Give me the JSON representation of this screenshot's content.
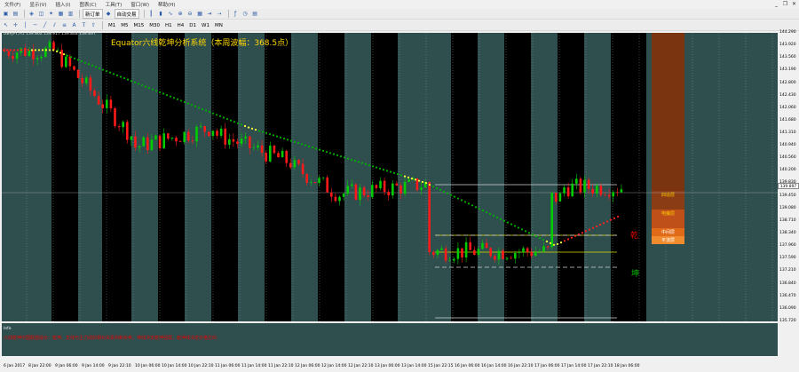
{
  "window": {
    "controls": [
      "_",
      "❐",
      "✕"
    ]
  },
  "menu": [
    "文件(F)",
    "显示(V)",
    "插入(I)",
    "图表(C)",
    "工具(T)",
    "窗口(W)",
    "帮助(H)"
  ],
  "toolbar": {
    "new_order": "新订单",
    "auto_trading": "自动交易",
    "timeframes": [
      "M1",
      "M5",
      "M15",
      "M30",
      "H1",
      "H4",
      "D1",
      "W1",
      "MN"
    ]
  },
  "chart": {
    "symbol_label": "GBPJPY,H1  139.862 139.917 139.848 139.897",
    "title": "Equator六线乾坤分析系统（本周波幅：368.5点）",
    "qian": "乾",
    "kun": "坤",
    "current_price": "139.897",
    "levels": [
      {
        "label": "四造层",
        "color": "#ffcc00",
        "bg": "#7a3410"
      },
      {
        "label": "电魔层",
        "color": "#ffcc00",
        "bg": "#c0501a"
      },
      {
        "label": "中间层",
        "color": "#ffffff",
        "bg": "#e06a18"
      },
      {
        "label": "平流层",
        "color": "#ffffff",
        "bg": "#f08c2e"
      }
    ],
    "info_label": "Info",
    "info_text": "六线乾坤中国联盟提示：乾坤、支线与主力线的相对关系判断买卖，坤线决定乾坤强弱，乾坤线决定价格方向"
  },
  "chart_data": {
    "type": "candlestick",
    "symbol": "GBPJPY",
    "timeframe": "H1",
    "y_ticks": [
      "144.290",
      "143.920",
      "143.560",
      "143.190",
      "142.800",
      "142.430",
      "142.060",
      "141.680",
      "141.310",
      "140.940",
      "140.560",
      "140.200",
      "139.830",
      "139.450",
      "139.080",
      "138.710",
      "138.340",
      "137.960",
      "137.590",
      "137.210",
      "136.840",
      "136.470",
      "136.090",
      "135.720"
    ],
    "x_ticks": [
      "6 Jan 2017",
      "8 Jan 22:00",
      "9 Jan 06:00",
      "9 Jan 14:00",
      "9 Jan 22:10",
      "10 Jan 06:00",
      "10 Jan 14:00",
      "10 Jan 22:10",
      "11 Jan 06:00",
      "11 Jan 14:00",
      "11 Jan 22:10",
      "12 Jan 06:00",
      "12 Jan 14:00",
      "12 Jan 22:10",
      "13 Jan 06:00",
      "13 Jan 14:00",
      "15 Jan 22:15",
      "16 Jan 06:00",
      "16 Jan 14:00",
      "16 Jan 22:10",
      "17 Jan 06:00",
      "17 Jan 14:00",
      "17 Jan 22:10",
      "18 Jan 06:00"
    ],
    "ylim": [
      135.72,
      144.29
    ]
  }
}
